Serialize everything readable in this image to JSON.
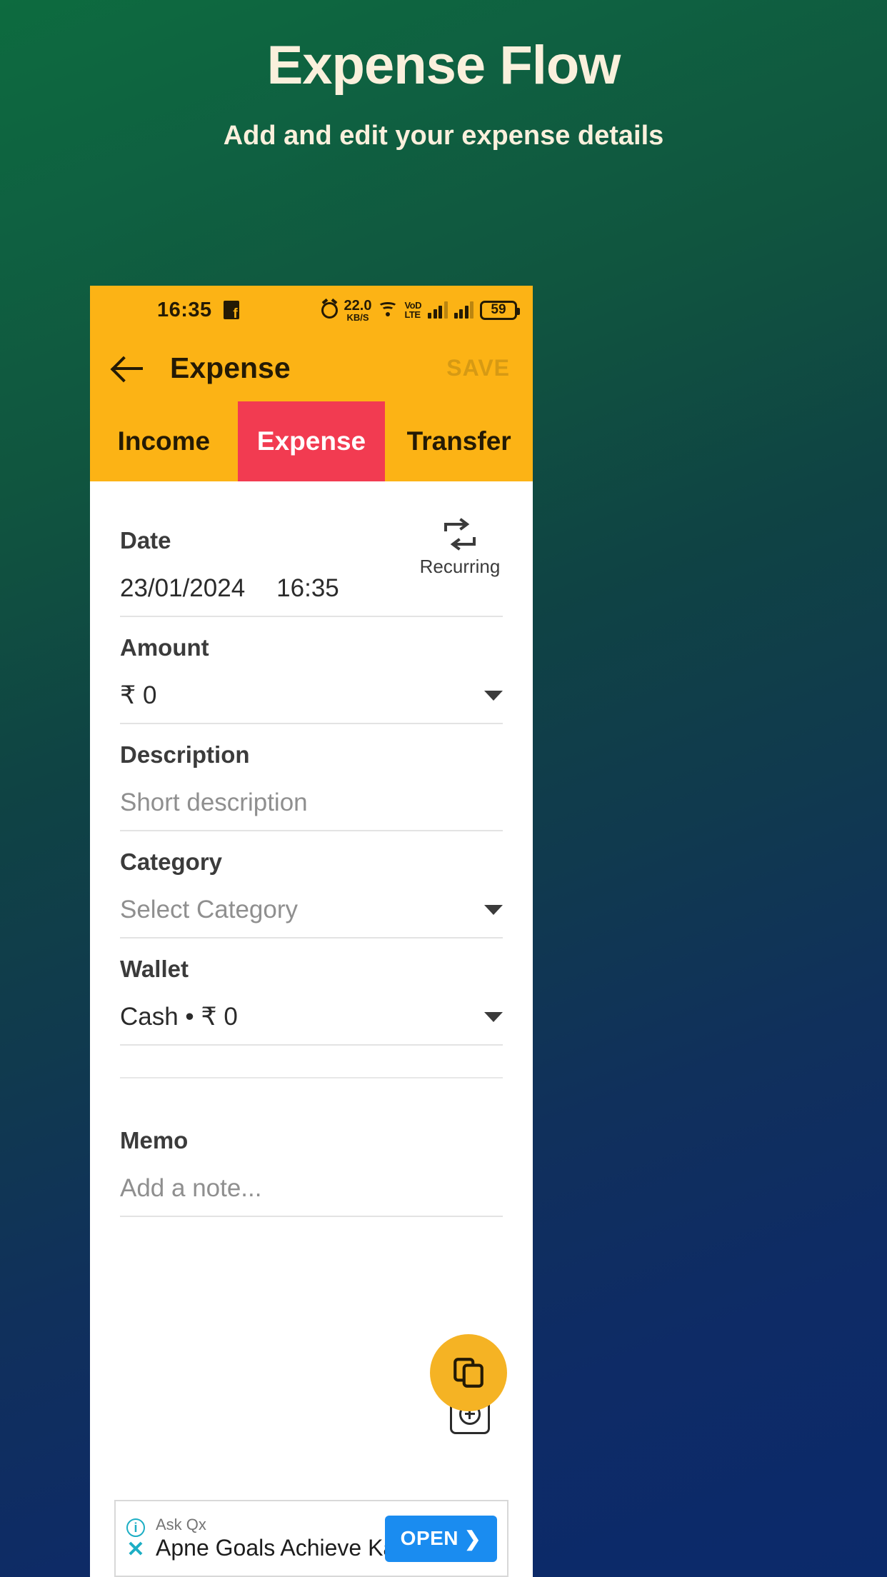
{
  "promo": {
    "title": "Expense Flow",
    "subtitle": "Add and edit your expense details"
  },
  "colors": {
    "brand_yellow": "#fcb315",
    "accent_red": "#f23b51",
    "fab_yellow": "#f5b324",
    "ad_blue": "#1a8cf0",
    "promo_text": "#faf0dc"
  },
  "statusbar": {
    "time": "16:35",
    "app_badge_icon": "facebook-icon",
    "alarm_icon": "alarm-icon",
    "network_speed_value": "22.0",
    "network_speed_unit": "KB/S",
    "wifi_icon": "wifi-icon",
    "volte_line1": "VoD",
    "volte_line2": "LTE",
    "signal_icon_1": "signal-bars-icon",
    "signal_icon_2": "signal-bars-icon",
    "battery_level": "59"
  },
  "appbar": {
    "back_icon": "back-arrow-icon",
    "title": "Expense",
    "save_label": "SAVE"
  },
  "tabs": [
    {
      "label": "Income",
      "active": false
    },
    {
      "label": "Expense",
      "active": true
    },
    {
      "label": "Transfer",
      "active": false
    }
  ],
  "form": {
    "date": {
      "label": "Date",
      "value": "23/01/2024",
      "time": "16:35",
      "recurring_icon": "repeat-icon",
      "recurring_label": "Recurring"
    },
    "amount": {
      "label": "Amount",
      "value": "₹ 0",
      "dropdown_icon": "chevron-down-icon"
    },
    "description": {
      "label": "Description",
      "placeholder": "Short description",
      "value": ""
    },
    "category": {
      "label": "Category",
      "placeholder": "Select Category",
      "value": "",
      "dropdown_icon": "chevron-down-icon"
    },
    "wallet": {
      "label": "Wallet",
      "value": "Cash • ₹ 0",
      "dropdown_icon": "chevron-down-icon"
    },
    "memo": {
      "label": "Memo",
      "placeholder": "Add a note...",
      "value": ""
    }
  },
  "fab": {
    "icon": "copy-icon"
  },
  "mini_fab": {
    "icon": "add-circle-icon"
  },
  "ad": {
    "info_icon": "info-icon",
    "close_icon": "close-icon",
    "advertiser": "Ask Qx",
    "headline": "Apne Goals Achieve Karo",
    "cta_label": "OPEN",
    "cta_arrow_icon": "chevron-right-icon"
  }
}
